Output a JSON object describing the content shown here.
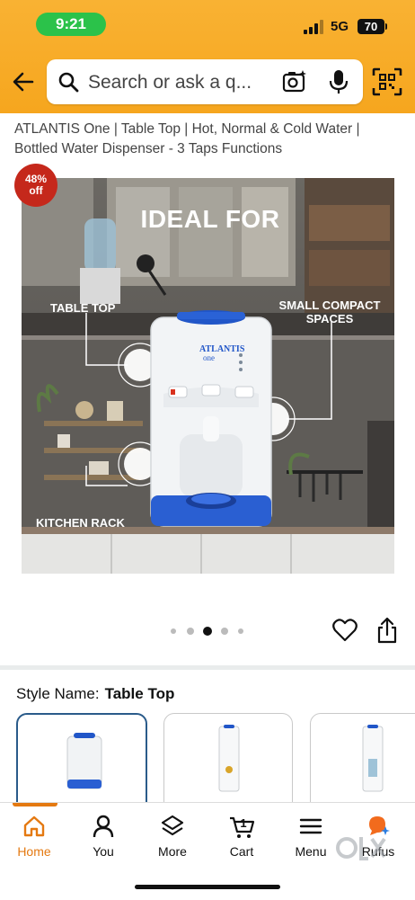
{
  "status": {
    "time": "9:21",
    "network": "5G",
    "battery": "70"
  },
  "search": {
    "placeholder": "Search or ask a q..."
  },
  "product": {
    "title": "ATLANTIS One | Table Top | Hot, Normal & Cold Water | Bottled Water Dispenser - 3 Taps Functions",
    "discount_top": "48%",
    "discount_bottom": "off",
    "image_text": {
      "headline": "IDEAL FOR",
      "cap_table": "TABLE TOP",
      "cap_small_1": "SMALL COMPACT",
      "cap_small_2": "SPACES",
      "cap_kitchen": "KITCHEN RACK",
      "brand_1": "ATLANTIS",
      "brand_2": "one"
    },
    "carousel": {
      "count": 5,
      "active_index": 2
    }
  },
  "style": {
    "label": "Style Name:",
    "value": "Table Top"
  },
  "nav": {
    "home": "Home",
    "you": "You",
    "more": "More",
    "cart": "Cart",
    "cart_count": "1",
    "menu": "Menu",
    "rufus": "Rufus"
  },
  "colors": {
    "accent": "#e47911",
    "header": "#f6a61e",
    "badge": "#c5281b",
    "selected_border": "#2a5b8a"
  }
}
